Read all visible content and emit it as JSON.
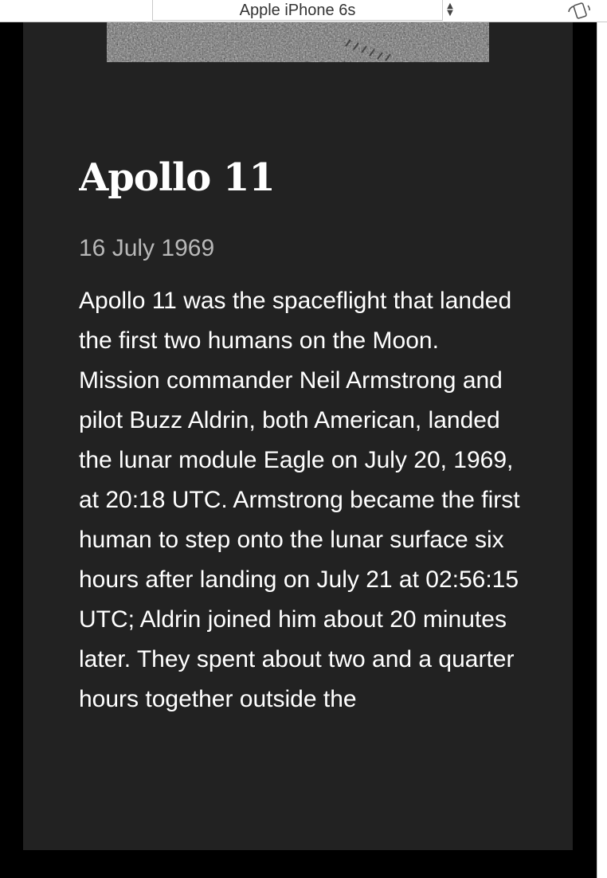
{
  "toolbar": {
    "device_label": "Apple iPhone 6s",
    "arrows_icon": "select-arrows-icon",
    "rotate_icon": "rotate-device-icon"
  },
  "article": {
    "title": "Apollo 11",
    "date": "16 July 1969",
    "body": "Apollo 11 was the spaceflight that landed the first two humans on the Moon. Mission commander Neil Armstrong and pilot Buzz Aldrin, both American, landed the lunar module Eagle on July 20, 1969, at 20:18 UTC. Armstrong became the first human to step onto the lunar surface six hours after landing on July 21 at 02:56:15 UTC; Aldrin joined him about 20 minutes later. They spent about two and a quarter hours together outside the"
  },
  "colors": {
    "page_bg": "#000000",
    "card_bg": "#222222",
    "title": "#ffffff",
    "date": "#b8b8b8",
    "body": "#ffffff"
  }
}
